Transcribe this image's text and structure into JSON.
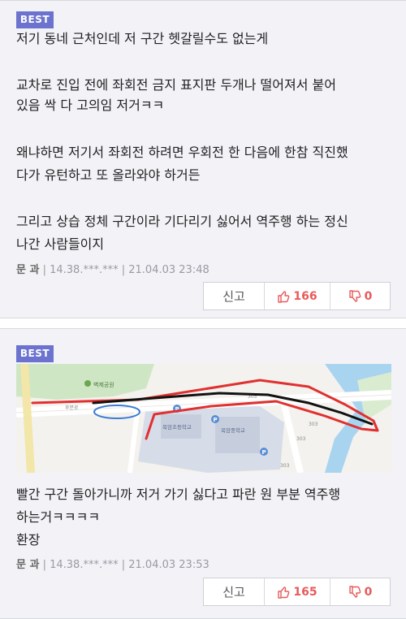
{
  "posts": [
    {
      "badge": "BEST",
      "lines": [
        "저기 동네 근처인데 저 구간 헷갈릴수도 없는게",
        "교차로 진입 전에 좌회전 금지 표지판 두개나 떨어져서 붙어",
        "있음 싹 다 고의임 저거ㅋㅋ",
        "왜냐하면 저기서 좌회전 하려면 우회전 한 다음에 한참 직진했",
        "다가 유턴하고 또 올라와야 하거든",
        "그리고 상습 정체 구간이라 기다리기 싫어서 역주행 하는 정신",
        "나간 사람들이지"
      ],
      "author": "문 과",
      "ip": "14.38.***.***",
      "time": "21.04.03 23:48",
      "report_label": "신고",
      "likes": "166",
      "dislikes": "0"
    },
    {
      "badge": "BEST",
      "map": {
        "park_label": "벽제공원",
        "school1": "목암초등학교",
        "school2": "목암중학교",
        "road_labels": [
          "후분로",
          "305",
          "303",
          "303",
          "303"
        ],
        "parking_icon": "P"
      },
      "lines": [
        "빨간 구간 돌아가니까 저거 가기 싫다고 파란 원 부분 역주행",
        "하는거ㅋㅋㅋㅋ",
        "환장"
      ],
      "author": "문 과",
      "ip": "14.38.***.***",
      "time": "21.04.03 23:53",
      "report_label": "신고",
      "likes": "165",
      "dislikes": "0"
    }
  ],
  "colors": {
    "badge": "#6c73cf",
    "card_bg": "#f2f2f7",
    "vote": "#e85a5a",
    "meta": "#9a9aa2"
  },
  "icons": [
    "thumbs-up-icon",
    "thumbs-down-icon"
  ]
}
